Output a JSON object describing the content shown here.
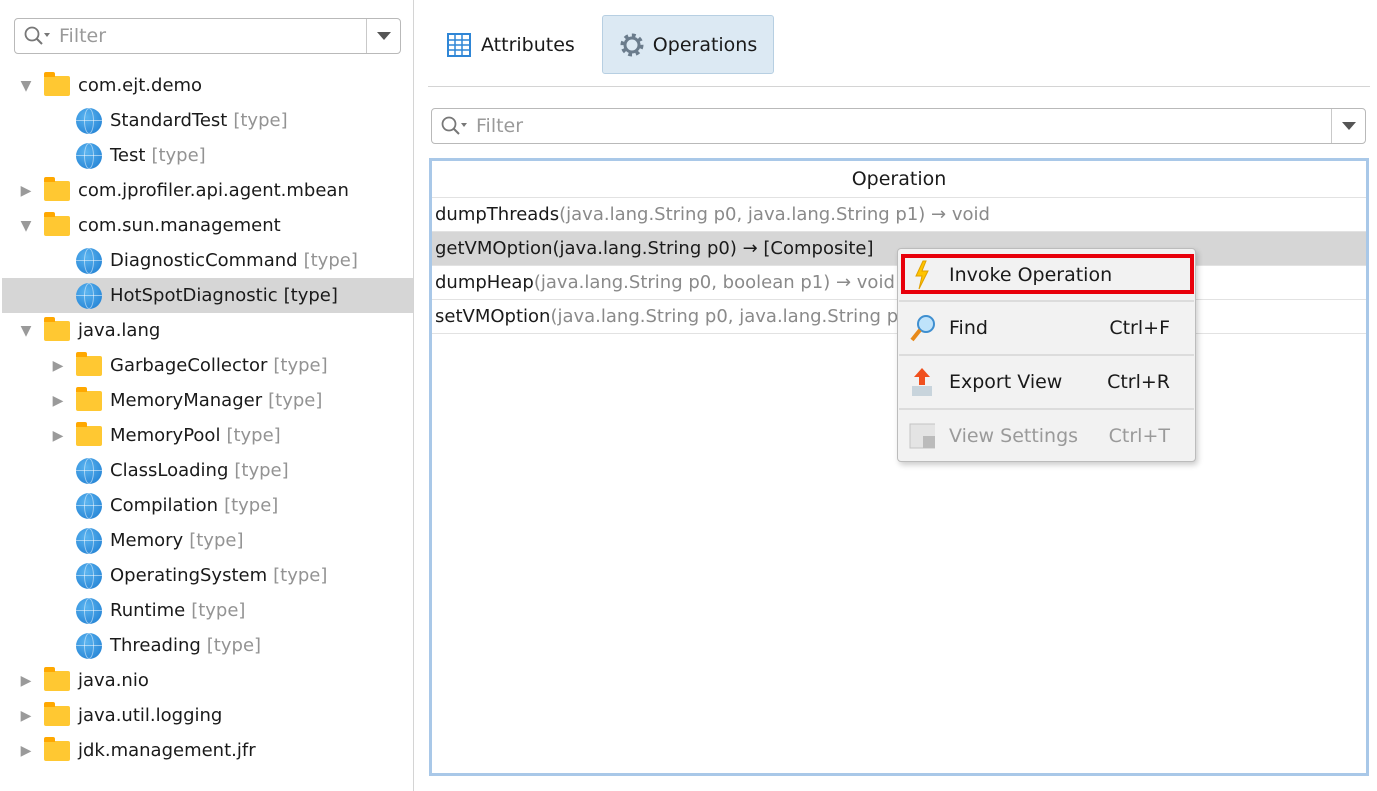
{
  "left_filter": {
    "placeholder": "Filter"
  },
  "tree": [
    {
      "label": "com.ejt.demo",
      "suffix": "",
      "kind": "folder",
      "expand": "open",
      "level": 0
    },
    {
      "label": "StandardTest",
      "suffix": "[type]",
      "kind": "globe",
      "expand": "",
      "level": 1
    },
    {
      "label": "Test",
      "suffix": "[type]",
      "kind": "globe",
      "expand": "",
      "level": 1
    },
    {
      "label": "com.jprofiler.api.agent.mbean",
      "suffix": "",
      "kind": "folder",
      "expand": "closed",
      "level": 0
    },
    {
      "label": "com.sun.management",
      "suffix": "",
      "kind": "folder",
      "expand": "open",
      "level": 0
    },
    {
      "label": "DiagnosticCommand",
      "suffix": "[type]",
      "kind": "globe",
      "expand": "",
      "level": 1
    },
    {
      "label": "HotSpotDiagnostic",
      "suffix": "[type]",
      "kind": "globe",
      "expand": "",
      "level": 1,
      "selected": true
    },
    {
      "label": "java.lang",
      "suffix": "",
      "kind": "folder",
      "expand": "open",
      "level": 0
    },
    {
      "label": "GarbageCollector",
      "suffix": "[type]",
      "kind": "folder",
      "expand": "closed",
      "level": 1
    },
    {
      "label": "MemoryManager",
      "suffix": "[type]",
      "kind": "folder",
      "expand": "closed",
      "level": 1
    },
    {
      "label": "MemoryPool",
      "suffix": "[type]",
      "kind": "folder",
      "expand": "closed",
      "level": 1
    },
    {
      "label": "ClassLoading",
      "suffix": "[type]",
      "kind": "globe",
      "expand": "",
      "level": 1
    },
    {
      "label": "Compilation",
      "suffix": "[type]",
      "kind": "globe",
      "expand": "",
      "level": 1
    },
    {
      "label": "Memory",
      "suffix": "[type]",
      "kind": "globe",
      "expand": "",
      "level": 1
    },
    {
      "label": "OperatingSystem",
      "suffix": "[type]",
      "kind": "globe",
      "expand": "",
      "level": 1
    },
    {
      "label": "Runtime",
      "suffix": "[type]",
      "kind": "globe",
      "expand": "",
      "level": 1
    },
    {
      "label": "Threading",
      "suffix": "[type]",
      "kind": "globe",
      "expand": "",
      "level": 1
    },
    {
      "label": "java.nio",
      "suffix": "",
      "kind": "folder",
      "expand": "closed",
      "level": 0
    },
    {
      "label": "java.util.logging",
      "suffix": "",
      "kind": "folder",
      "expand": "closed",
      "level": 0
    },
    {
      "label": "jdk.management.jfr",
      "suffix": "",
      "kind": "folder",
      "expand": "closed",
      "level": 0
    }
  ],
  "tabs": [
    {
      "label": "Attributes",
      "icon": "table-icon"
    },
    {
      "label": "Operations",
      "icon": "gear-icon",
      "active": true
    }
  ],
  "right_filter": {
    "placeholder": "Filter"
  },
  "table": {
    "header": "Operation",
    "rows": [
      {
        "name": "dumpThreads",
        "sig": "(java.lang.String p0, java.lang.String p1) → void"
      },
      {
        "name": "getVMOption",
        "sig": "(java.lang.String p0) → [Composite]",
        "selected": true
      },
      {
        "name": "dumpHeap",
        "sig": "(java.lang.String p0, boolean p1) → void"
      },
      {
        "name": "setVMOption",
        "sig": "(java.lang.String p0, java.lang.String p1) → void"
      }
    ]
  },
  "context_menu": [
    {
      "label": "Invoke Operation",
      "shortcut": "",
      "icon": "lightning-icon",
      "highlighted": true
    },
    {
      "label": "Find",
      "shortcut": "Ctrl+F",
      "icon": "magnifier-icon"
    },
    {
      "label": "Export View",
      "shortcut": "Ctrl+R",
      "icon": "export-icon"
    },
    {
      "label": "View Settings",
      "shortcut": "Ctrl+T",
      "icon": "view-settings-icon",
      "disabled": true
    }
  ],
  "colors": {
    "highlight_box": "#e8000b",
    "selection": "#d6d6d6",
    "table_border": "#a9c8e8",
    "active_tab": "#dce9f3"
  }
}
